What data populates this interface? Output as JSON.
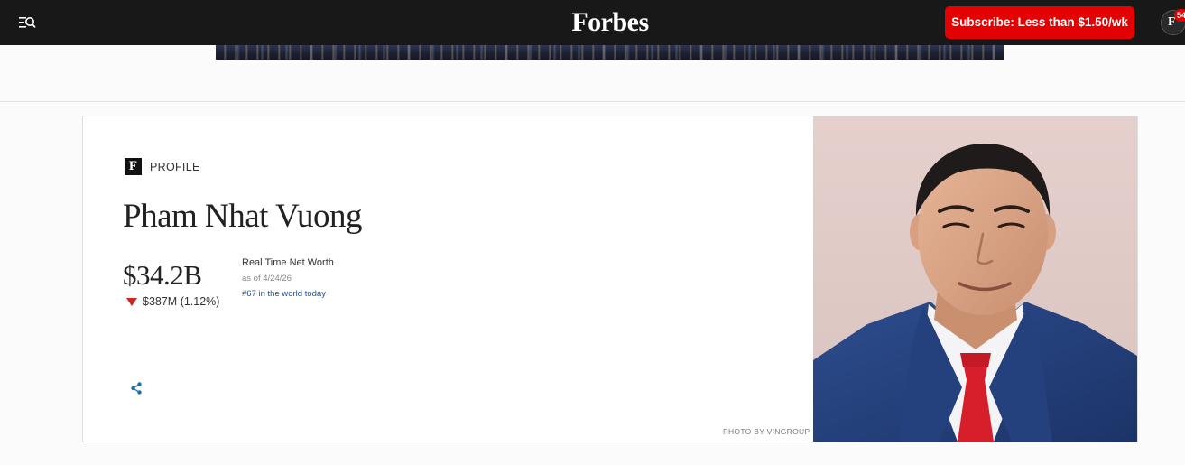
{
  "header": {
    "logo_text": "Forbes",
    "subscribe_label": "Subscribe: Less than $1.50/wk",
    "avatar_initial": "F",
    "notification_count": "54"
  },
  "profile": {
    "tag_logo": "F",
    "tag_label": "PROFILE",
    "name": "Pham Nhat Vuong",
    "net_worth": "$34.2B",
    "change": "$387M (1.12%)",
    "change_direction": "down",
    "real_time_label": "Real Time Net Worth",
    "as_of": "as of 4/24/26",
    "rank": "#67 in the world today",
    "photo_credit": "PHOTO BY VINGROUP"
  },
  "colors": {
    "topbar": "#181818",
    "subscribe": "#e40101",
    "down_arrow": "#d0271c",
    "rank_link": "#1a4f9c",
    "share_icon": "#1a6fa8"
  },
  "icons": {
    "menu": "menu-search-icon",
    "share": "share-icon",
    "change": "triangle-down-icon"
  }
}
